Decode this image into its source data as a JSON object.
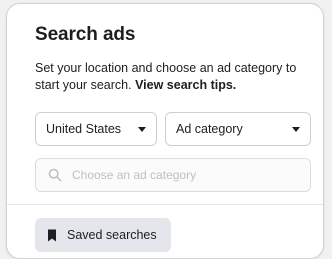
{
  "panel": {
    "title": "Search ads",
    "description": "Set your location and choose an ad category to start your search.",
    "tips_link": "View search tips."
  },
  "filters": {
    "country": "United States",
    "category": "Ad category"
  },
  "search": {
    "placeholder": "Choose an ad category",
    "value": ""
  },
  "saved": {
    "label": "Saved searches"
  },
  "icons": {
    "search": "search-icon",
    "bookmark": "bookmark-icon",
    "caret": "chevron-down-icon"
  },
  "colors": {
    "text": "#1c1e21",
    "border": "#ccd0d5",
    "button_bg": "#e4e6eb",
    "placeholder": "#bcc0c4"
  }
}
